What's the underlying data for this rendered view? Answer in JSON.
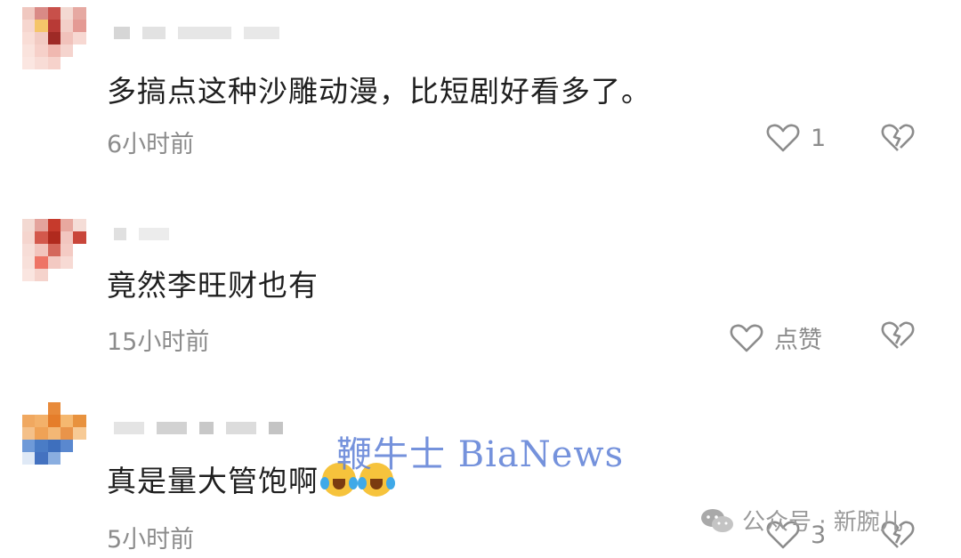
{
  "comments": [
    {
      "text": "多搞点这种沙雕动漫，比短剧好看多了。",
      "time": "6小时前",
      "like_label": "1"
    },
    {
      "text": "竟然李旺财也有",
      "time": "15小时前",
      "like_label": "点赞"
    },
    {
      "text": "真是量大管饱啊",
      "time": "5小时前",
      "like_label": "3"
    }
  ],
  "watermark": "鞭牛士 BiaNews",
  "source_label": "公众号 · 新腕儿",
  "colors": {
    "text": "#1f1f1f",
    "meta": "#8c8c8c",
    "watermark": "#5d7fd6"
  }
}
